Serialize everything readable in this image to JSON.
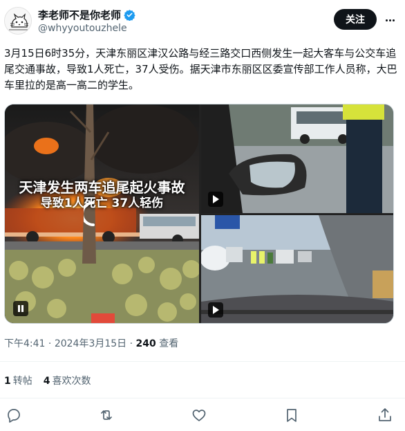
{
  "author": {
    "display_name": "李老师不是你老师",
    "handle": "@whyyoutouzhele",
    "verified_icon": "verified-badge-icon"
  },
  "header": {
    "follow_label": "关注",
    "more_icon": "more-options-icon"
  },
  "tweet": {
    "text": "3月15日6时35分，天津东丽区津汉公路与经三路交口西侧发生一起大客车与公交车追尾交通事故，导致1人死亡，37人受伤。据天津市东丽区区委宣传部工作人员称，大巴车里拉的是高一高二的学生。"
  },
  "media": {
    "video1": {
      "caption_line1": "天津发生两车追尾起火事故",
      "caption_line2": "导致1人死亡 37人轻伤",
      "control_icon": "pause-icon"
    },
    "video2": {
      "control_icon": "play-icon"
    },
    "video3": {
      "control_icon": "play-icon"
    }
  },
  "meta": {
    "time": "下午4:41",
    "separator": "·",
    "date": "2024年3月15日",
    "views_count": "240",
    "views_label": "查看"
  },
  "stats": {
    "reposts_count": "1",
    "reposts_label": "转帖",
    "likes_count": "4",
    "likes_label": "喜欢次数"
  },
  "actions": {
    "icons": [
      "reply-icon",
      "repost-icon",
      "like-icon",
      "bookmark-icon",
      "share-icon"
    ]
  },
  "colors": {
    "text_primary": "#0f1419",
    "text_secondary": "#536471",
    "verified_blue": "#1d9bf0",
    "follow_bg": "#0f1419",
    "divider": "#eff3f4"
  }
}
